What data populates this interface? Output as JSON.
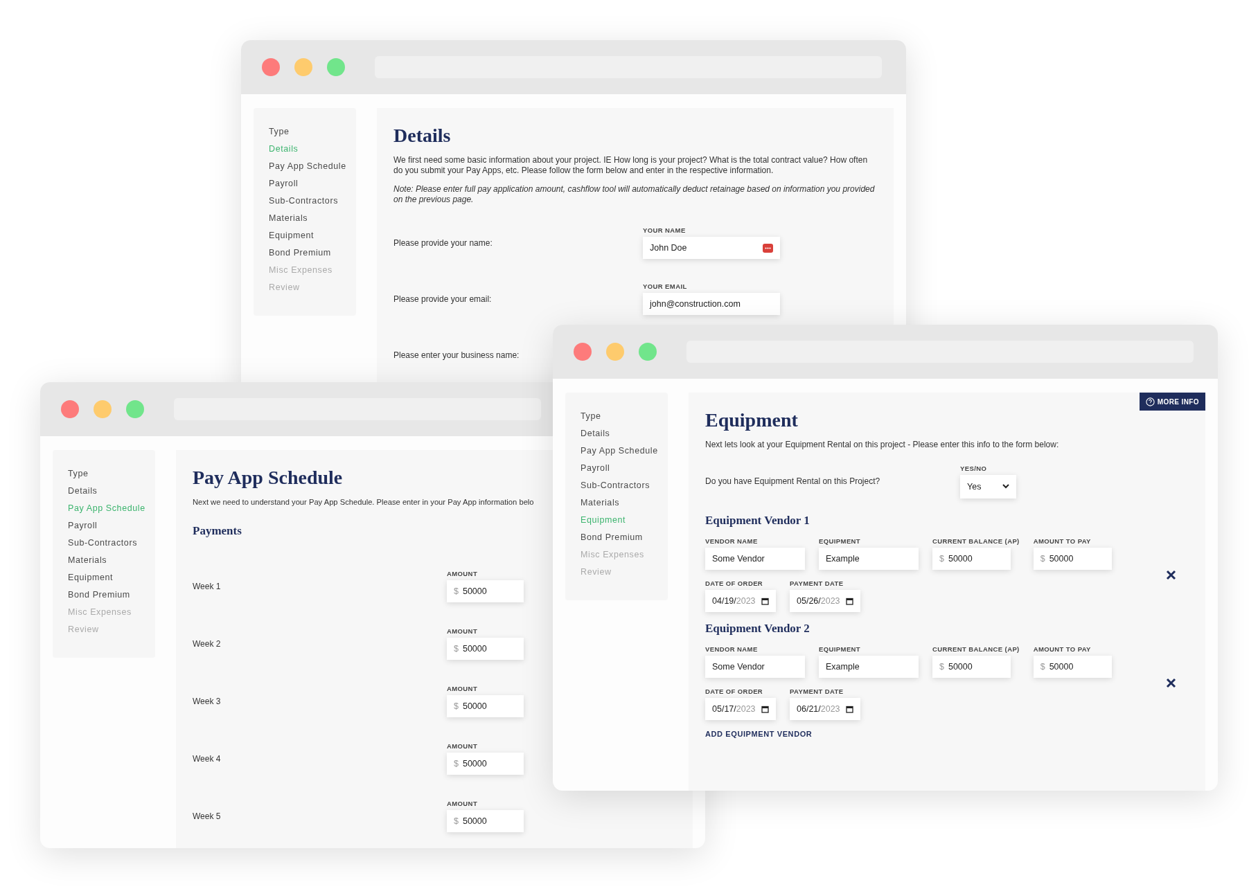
{
  "details_window": {
    "nav": [
      {
        "label": "Type",
        "selected": false,
        "disabled": false
      },
      {
        "label": "Details",
        "selected": true,
        "disabled": false
      },
      {
        "label": "Pay App Schedule",
        "selected": false,
        "disabled": false
      },
      {
        "label": "Payroll",
        "selected": false,
        "disabled": false
      },
      {
        "label": "Sub-Contractors",
        "selected": false,
        "disabled": false
      },
      {
        "label": "Materials",
        "selected": false,
        "disabled": false
      },
      {
        "label": "Equipment",
        "selected": false,
        "disabled": false
      },
      {
        "label": "Bond Premium",
        "selected": false,
        "disabled": false
      },
      {
        "label": "Misc Expenses",
        "selected": false,
        "disabled": true
      },
      {
        "label": "Review",
        "selected": false,
        "disabled": true
      }
    ],
    "title": "Details",
    "intro": "We first need some basic information about your project. IE How long is your project? What is the total contract value? How often do you submit your Pay Apps, etc. Please follow the form below and enter in the respective information.",
    "note": "Note: Please enter full pay application amount, cashflow tool will automatically deduct retainage based on information you provided on the previous page.",
    "rows": [
      {
        "prompt": "Please provide your name:",
        "field_label": "YOUR NAME",
        "value": "John Doe",
        "autofill_icon": true
      },
      {
        "prompt": "Please provide your email:",
        "field_label": "YOUR EMAIL",
        "value": "john@construction.com",
        "autofill_icon": false
      },
      {
        "prompt": "Please enter your business name:"
      }
    ]
  },
  "pay_app_window": {
    "nav": [
      {
        "label": "Type",
        "selected": false,
        "disabled": false
      },
      {
        "label": "Details",
        "selected": false,
        "disabled": false
      },
      {
        "label": "Pay App Schedule",
        "selected": true,
        "disabled": false
      },
      {
        "label": "Payroll",
        "selected": false,
        "disabled": false
      },
      {
        "label": "Sub-Contractors",
        "selected": false,
        "disabled": false
      },
      {
        "label": "Materials",
        "selected": false,
        "disabled": false
      },
      {
        "label": "Equipment",
        "selected": false,
        "disabled": false
      },
      {
        "label": "Bond Premium",
        "selected": false,
        "disabled": false
      },
      {
        "label": "Misc Expenses",
        "selected": false,
        "disabled": true
      },
      {
        "label": "Review",
        "selected": false,
        "disabled": true
      }
    ],
    "title": "Pay App Schedule",
    "intro": "Next we need to understand your Pay App Schedule. Please enter in your Pay App information belo",
    "section": "Payments",
    "weeks": [
      {
        "label": "Week 1",
        "field_label": "AMOUNT",
        "prefix": "$",
        "value": "50000"
      },
      {
        "label": "Week 2",
        "field_label": "AMOUNT",
        "prefix": "$",
        "value": "50000"
      },
      {
        "label": "Week 3",
        "field_label": "AMOUNT",
        "prefix": "$",
        "value": "50000"
      },
      {
        "label": "Week 4",
        "field_label": "AMOUNT",
        "prefix": "$",
        "value": "50000"
      },
      {
        "label": "Week 5",
        "field_label": "AMOUNT",
        "prefix": "$",
        "value": "50000"
      }
    ]
  },
  "equipment_window": {
    "nav": [
      {
        "label": "Type",
        "selected": false,
        "disabled": false
      },
      {
        "label": "Details",
        "selected": false,
        "disabled": false
      },
      {
        "label": "Pay App Schedule",
        "selected": false,
        "disabled": false
      },
      {
        "label": "Payroll",
        "selected": false,
        "disabled": false
      },
      {
        "label": "Sub-Contractors",
        "selected": false,
        "disabled": false
      },
      {
        "label": "Materials",
        "selected": false,
        "disabled": false
      },
      {
        "label": "Equipment",
        "selected": true,
        "disabled": false
      },
      {
        "label": "Bond Premium",
        "selected": false,
        "disabled": false
      },
      {
        "label": "Misc Expenses",
        "selected": false,
        "disabled": true
      },
      {
        "label": "Review",
        "selected": false,
        "disabled": true
      }
    ],
    "more_info": "MORE INFO",
    "title": "Equipment",
    "intro": "Next lets look at your Equipment Rental on this project - Please enter this info to the form below:",
    "question": {
      "prompt": "Do you have Equipment Rental on this Project?",
      "field_label": "YES/NO",
      "value": "Yes"
    },
    "vendors": [
      {
        "title": "Equipment Vendor 1",
        "fields": [
          {
            "kind": "text",
            "label": "VENDOR NAME",
            "value": "Some Vendor"
          },
          {
            "kind": "text",
            "label": "EQUIPMENT",
            "value": "Example"
          },
          {
            "kind": "money",
            "label": "CURRENT BALANCE (AP)",
            "prefix": "$",
            "value": "50000"
          },
          {
            "kind": "money",
            "label": "AMOUNT TO PAY",
            "prefix": "$",
            "value": "50000"
          }
        ],
        "dates": [
          {
            "label": "DATE OF ORDER",
            "value": "04/19/",
            "year": "2023"
          },
          {
            "label": "PAYMENT DATE",
            "value": "05/26/",
            "year": "2023"
          }
        ]
      },
      {
        "title": "Equipment Vendor 2",
        "fields": [
          {
            "kind": "text",
            "label": "VENDOR NAME",
            "value": "Some Vendor"
          },
          {
            "kind": "text",
            "label": "EQUIPMENT",
            "value": "Example"
          },
          {
            "kind": "money",
            "label": "CURRENT BALANCE (AP)",
            "prefix": "$",
            "value": "50000"
          },
          {
            "kind": "money",
            "label": "AMOUNT TO PAY",
            "prefix": "$",
            "value": "50000"
          }
        ],
        "dates": [
          {
            "label": "DATE OF ORDER",
            "value": "05/17/",
            "year": "2023"
          },
          {
            "label": "PAYMENT DATE",
            "value": "06/21/",
            "year": "2023"
          }
        ]
      }
    ],
    "add_link": "ADD EQUIPMENT VENDOR"
  }
}
